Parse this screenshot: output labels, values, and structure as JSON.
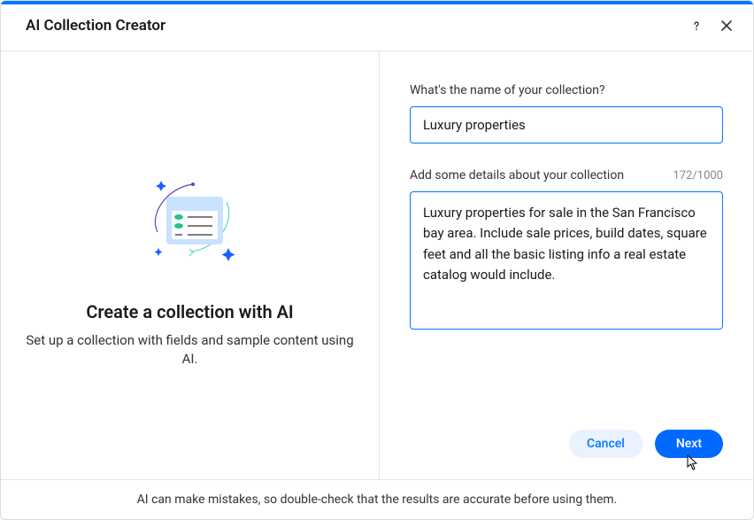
{
  "header": {
    "title": "AI Collection Creator"
  },
  "left": {
    "title": "Create a collection with AI",
    "subtitle": "Set up a collection with fields and sample content using AI."
  },
  "form": {
    "name_label": "What's the name of your collection?",
    "name_value": "Luxury properties",
    "details_label": "Add some details about your collection",
    "details_value": "Luxury properties for sale in the San Francisco bay area. Include sale prices, build dates, square feet and all the basic listing info a real estate catalog would include.",
    "char_count": "172/1000"
  },
  "buttons": {
    "cancel": "Cancel",
    "next": "Next"
  },
  "footer": {
    "disclaimer": "AI can make mistakes, so double-check that the results are accurate before using them."
  }
}
